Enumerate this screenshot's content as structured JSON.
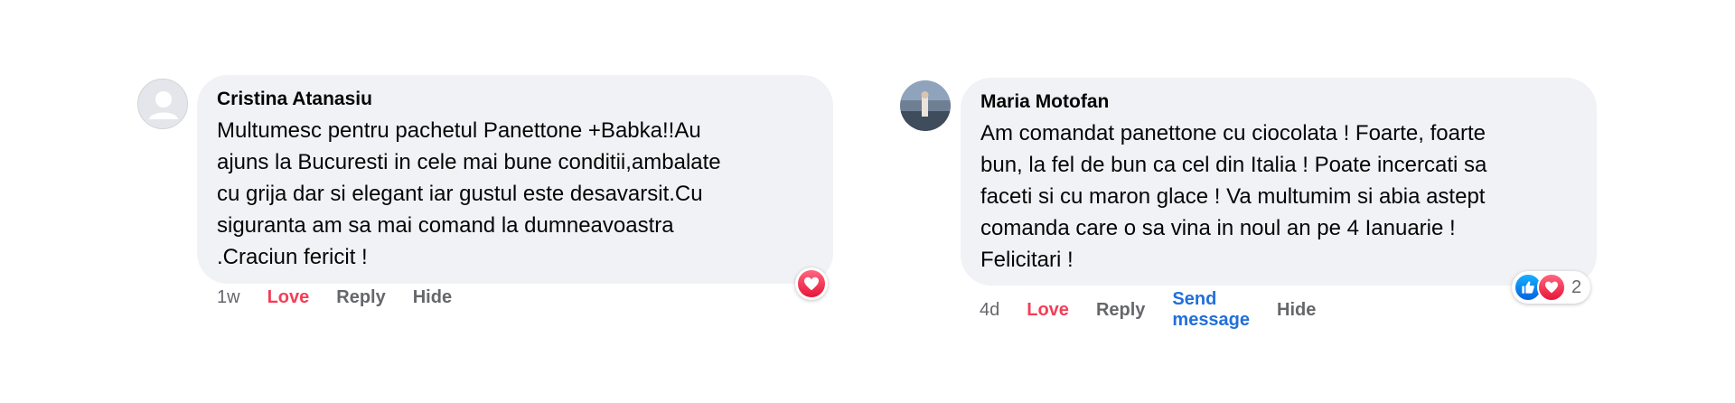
{
  "comments": [
    {
      "author": "Cristina Atanasiu",
      "lines": [
        "Multumesc pentru pachetul Panettone +Babka!!Au",
        "ajuns la Bucuresti in cele mai bune conditii,ambalate",
        "cu grija dar si elegant iar gustul este desavarsit.Cu",
        "siguranta am sa mai comand la dumneavoastra",
        ".Craciun fericit !"
      ],
      "time": "1w",
      "actions": {
        "love": "Love",
        "reply": "Reply",
        "hide": "Hide"
      },
      "avatar": "default-avatar-icon",
      "reactions": [
        "heart-icon"
      ]
    },
    {
      "author": "Maria Motofan",
      "lines": [
        "Am comandat panettone cu ciocolata ! Foarte, foarte",
        "bun, la fel de bun ca cel din Italia ! Poate incercati sa",
        "faceti si cu maron glace ! Va multumim si abia astept",
        "comanda care o sa vina in noul an pe 4 Ianuarie !",
        "Felicitari !"
      ],
      "time": "4d",
      "actions": {
        "love": "Love",
        "reply": "Reply",
        "send_message": "Send message",
        "hide": "Hide"
      },
      "avatar": "profile-photo",
      "reactions": [
        "like-icon",
        "heart-icon"
      ],
      "reaction_count": "2"
    }
  ],
  "colors": {
    "bubble": "#f0f2f5",
    "love": "#f33e58",
    "send_message": "#216fdb",
    "muted": "#65676b"
  }
}
